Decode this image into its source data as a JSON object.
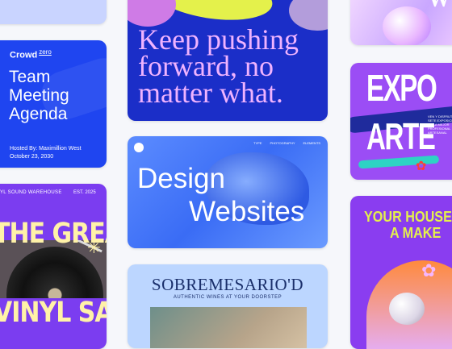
{
  "cards": {
    "team_meeting": {
      "brand": "Crowd",
      "brand_suffix": "zero",
      "title_lines": [
        "Team",
        "Meeting",
        "Agenda"
      ],
      "hosted_by": "Hosted By: Maximillion West",
      "date": "October 23, 2030"
    },
    "vinyl": {
      "shop": "YL SOUND WAREHOUSE",
      "est": "EST. 2025",
      "line1": "THE GREAT",
      "line2": "VINYL SALE"
    },
    "keep_pushing": {
      "lines": [
        "Keep pushing",
        "forward, no",
        "matter what."
      ]
    },
    "design_websites": {
      "nav": [
        "TYPE",
        "PHOTOGRAPHY",
        "ELEMENTS"
      ],
      "title_lines": [
        "Design",
        "Websites"
      ]
    },
    "sobremesa": {
      "title": "SOBREMESARIO'D",
      "subtitle": "AUTHENTIC WINES AT YOUR DOORSTEP"
    },
    "top_right": {
      "fragment": "W"
    },
    "expo": {
      "line1": "EXPO",
      "line2": "ARTE",
      "small_text": "VEN Y DISFRUTA DE SETE EXPOSICIÓN DE LA MEJOR PROFESIONAL ARTESANAL"
    },
    "your_house": {
      "line1": "YOUR HOUSE",
      "line2": "A MAKE"
    }
  },
  "colors": {
    "blue": "#1f45f0",
    "navy": "#1b2ec8",
    "purple": "#7b3df0",
    "lavender": "#e8b4ff",
    "yellow": "#e4f14b"
  }
}
